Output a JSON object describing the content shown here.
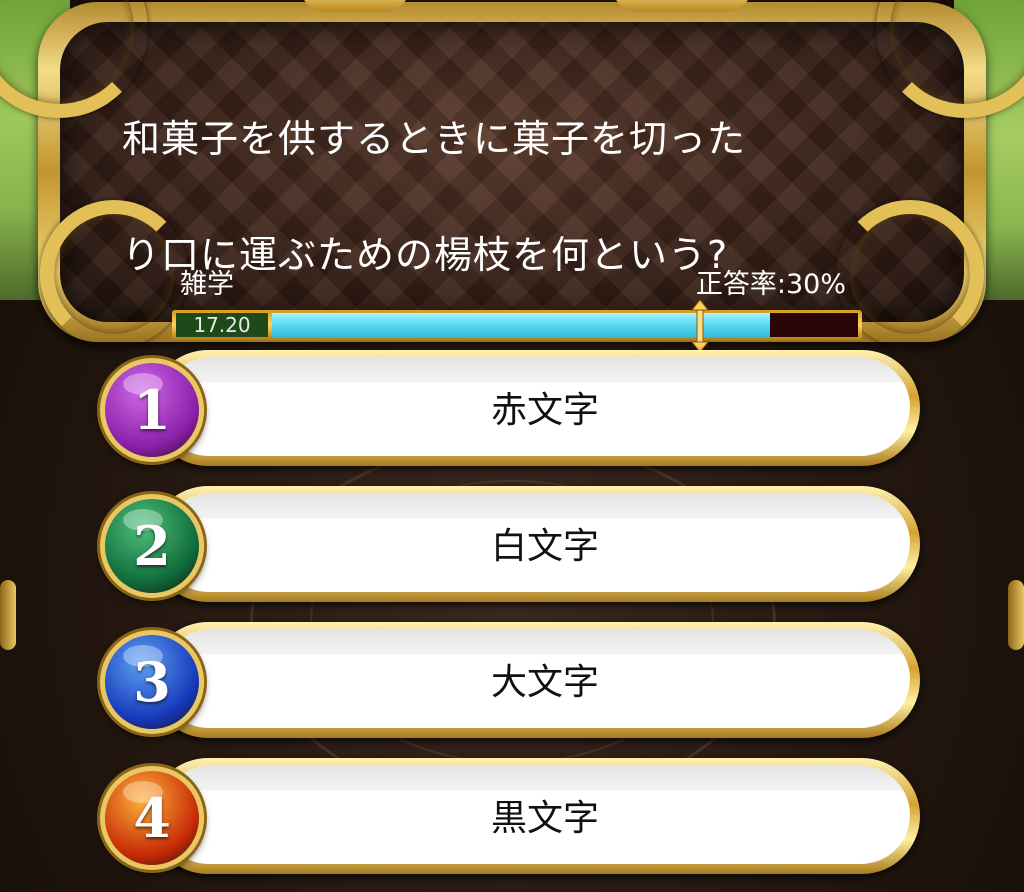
{
  "question": {
    "text": "和菓子を供するときに菓子を切ったり口に運ぶための楊枝を何という?",
    "line1": "和菓子を供するときに菓子を切った",
    "line2": "り口に運ぶための楊枝を何という?",
    "genre": "雑学",
    "correct_rate": "正答率:30%"
  },
  "timer": {
    "time_left": "17.20",
    "fill_fraction": 0.85,
    "fill_color": "#59d8f2"
  },
  "answers": [
    {
      "number": "1",
      "label": "赤文字",
      "badge_color": "#8a1fa8",
      "badge_highlight": "#d06ae8"
    },
    {
      "number": "2",
      "label": "白文字",
      "badge_color": "#0f6a3a",
      "badge_highlight": "#4ec07a"
    },
    {
      "number": "3",
      "label": "大文字",
      "badge_color": "#1638b8",
      "badge_highlight": "#5ea2f5"
    },
    {
      "number": "4",
      "label": "黒文字",
      "badge_color": "#c62a06",
      "badge_highlight": "#ffb13a"
    }
  ],
  "colors": {
    "gold": "#e3bf57",
    "panel": "#3a2219"
  }
}
